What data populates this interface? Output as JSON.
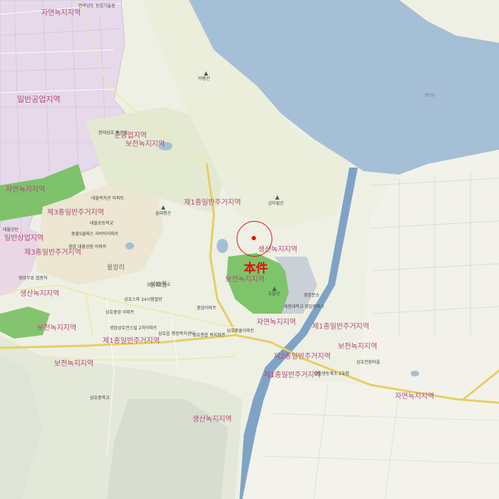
{
  "map": {
    "zones": [
      {
        "id": "zone-jayeon-top",
        "text": "자연녹지지역"
      },
      {
        "id": "zone-ilban-gongeop",
        "text": "일반공업지역"
      },
      {
        "id": "zone-jungong-up",
        "text": "준공업지역"
      },
      {
        "id": "zone-bojeon-top",
        "text": "보전녹지지역"
      },
      {
        "id": "zone-jayeon-left",
        "text": "자연녹지지역"
      },
      {
        "id": "zone-je3-left",
        "text": "제3종일반주거지역"
      },
      {
        "id": "zone-ilban-sangeop",
        "text": "일반상업지역"
      },
      {
        "id": "zone-je1-center",
        "text": "제1종일반주거지역"
      },
      {
        "id": "zone-je3-2",
        "text": "제3종일반주거지역"
      },
      {
        "id": "zone-saengsan-center",
        "text": "생산녹지지역"
      },
      {
        "id": "zone-bojeon-center",
        "text": "보전녹지지역"
      },
      {
        "id": "zone-saengsan-left",
        "text": "생산녹지지역"
      },
      {
        "id": "zone-bojeon-left",
        "text": "보전녹지지역"
      },
      {
        "id": "zone-jayeon-center",
        "text": "자연녹지지역"
      },
      {
        "id": "zone-je1-right",
        "text": "제1종일반주거지역"
      },
      {
        "id": "zone-bojeon-right",
        "text": "보전녹지지역"
      },
      {
        "id": "zone-je1-bottom",
        "text": "제1종일반주거지역"
      },
      {
        "id": "zone-je2",
        "text": "제2종일반주거지역"
      },
      {
        "id": "zone-je1-bottom2",
        "text": "제1종일반주거지역"
      },
      {
        "id": "zone-bojeon-bottomleft",
        "text": "보전녹지지역"
      },
      {
        "id": "zone-jayeon-bottomright",
        "text": "자연녹지지역"
      },
      {
        "id": "zone-saengsan-bottom",
        "text": "생산녹지지역"
      }
    ],
    "peaks": [
      {
        "id": "peak-baramsan",
        "text": "바람산"
      },
      {
        "id": "peak-geumdasan",
        "text": "금다릴산"
      },
      {
        "id": "peak-seoldaesan",
        "text": "솔대봉산"
      },
      {
        "id": "peak-hwaeulsan",
        "text": "호을산"
      }
    ],
    "places": [
      {
        "id": "place-top",
        "text": "전라남도 농업기술원"
      },
      {
        "id": "place-hyundai",
        "text": "현대삼호 중공업"
      },
      {
        "id": "place-daebul-a",
        "text": "대불복지관 아파트"
      },
      {
        "id": "place-daebul-school",
        "text": "대불초등학교"
      },
      {
        "id": "place-samho-apt",
        "text": "중흥S클래스 리버티아파트"
      },
      {
        "id": "place-yeongam-apt",
        "text": "영암 대불공원 아파트"
      },
      {
        "id": "place-yongdang",
        "text": "용앙리"
      },
      {
        "id": "place-samho-dong",
        "text": "삼호동"
      },
      {
        "id": "place-samho-school",
        "text": "삼호초등학교"
      },
      {
        "id": "place-samho-sports",
        "text": "삼호스파 24시찜질방"
      },
      {
        "id": "place-samho-center",
        "text": "삼호중앙 아파트"
      },
      {
        "id": "place-jungang-apt",
        "text": "중앙아파트"
      },
      {
        "id": "place-samho-eup",
        "text": "삼호읍 행정복지센터"
      },
      {
        "id": "place-samho-market",
        "text": "영암삼호전스틸 2차아파트"
      },
      {
        "id": "place-samho-hotel",
        "text": "삼호종합 복지회관"
      },
      {
        "id": "place-sehan",
        "text": "세한대학교 영암캠퍼스"
      },
      {
        "id": "place-sejin-apt",
        "text": "삼호중흥아파트"
      },
      {
        "id": "place-yeongam-office",
        "text": "영암분소"
      },
      {
        "id": "place-samho-middle",
        "text": "삼호중학교"
      },
      {
        "id": "place-gangchim",
        "text": "강침생동계소 2호점"
      },
      {
        "id": "place-samho-church",
        "text": "삼호전원마을"
      },
      {
        "id": "place-left-1",
        "text": "영암무료 접종처"
      },
      {
        "id": "place-left-2",
        "text": "대불공단"
      },
      {
        "id": "place-sea",
        "text": "영산강"
      }
    ],
    "marker": {
      "label": "本件"
    }
  }
}
